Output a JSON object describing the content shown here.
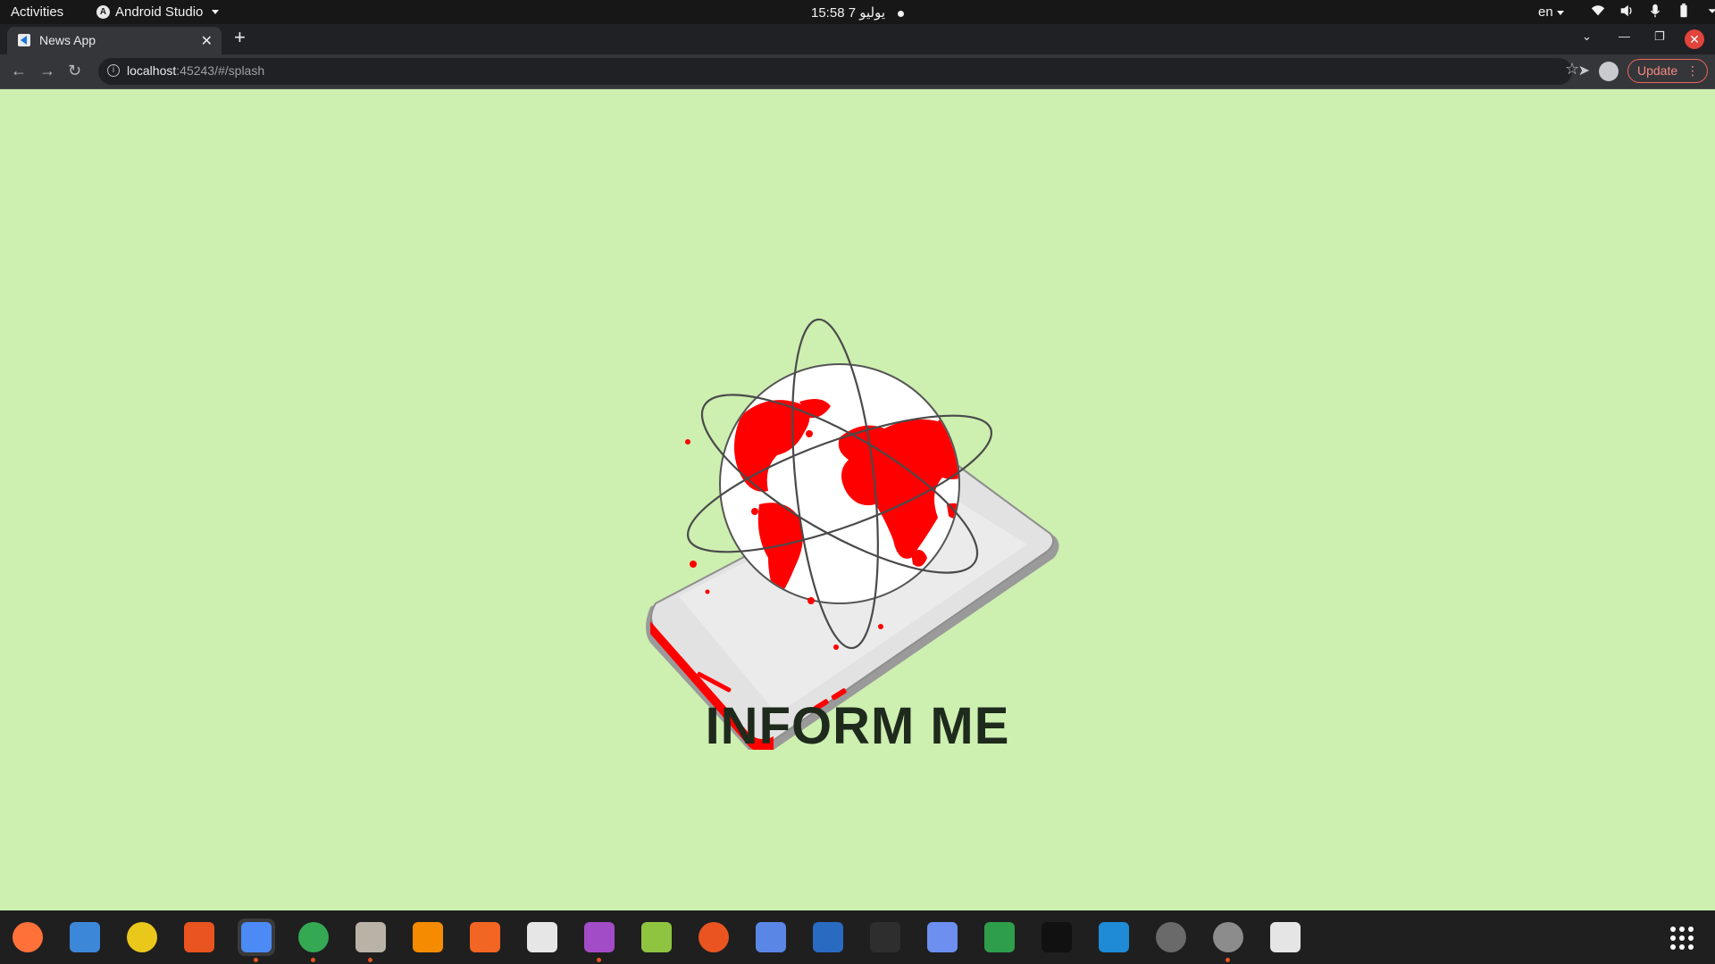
{
  "topbar": {
    "activities": "Activities",
    "app_name": "Android Studio",
    "clock": "15:58  7 يوليو",
    "lang": "en"
  },
  "browser": {
    "tab_title": "News App",
    "url_host": "localhost",
    "url_path": ":45243/#/splash",
    "update_label": "Update"
  },
  "page": {
    "title": "INFORM ME"
  },
  "colors": {
    "background": "#cdefb0",
    "accent_red": "#ff0000",
    "title": "#1e2a1c"
  },
  "dock": {
    "items": [
      {
        "name": "firefox-icon",
        "color": "#ff7139",
        "running": false
      },
      {
        "name": "thunderbird-icon",
        "color": "#3c87d8",
        "running": false
      },
      {
        "name": "rhythmbox-icon",
        "color": "#e9c81b",
        "running": false
      },
      {
        "name": "software-center-icon",
        "color": "#e95420",
        "running": false
      },
      {
        "name": "android-studio-icon",
        "color": "#4c8bf5",
        "running": true,
        "active": true
      },
      {
        "name": "chrome-icon",
        "color": "#34a853",
        "running": true
      },
      {
        "name": "files-icon",
        "color": "#b9b2a6",
        "running": true
      },
      {
        "name": "vlc-icon",
        "color": "#f48b00",
        "running": false
      },
      {
        "name": "draw-icon",
        "color": "#f26522",
        "running": false
      },
      {
        "name": "text-editor-icon",
        "color": "#e6e6e6",
        "running": false
      },
      {
        "name": "video-icon",
        "color": "#a34cc7",
        "running": true
      },
      {
        "name": "gitkraken-icon",
        "color": "#8fc441",
        "running": false
      },
      {
        "name": "ubuntu-icon",
        "color": "#e95420",
        "running": false
      },
      {
        "name": "tasks-icon",
        "color": "#5a86e6",
        "running": false
      },
      {
        "name": "writer-icon",
        "color": "#2a6bc2",
        "running": false
      },
      {
        "name": "terminal-icon",
        "color": "#2e2e2e",
        "running": false
      },
      {
        "name": "screenshot-icon",
        "color": "#6c8ff0",
        "running": false
      },
      {
        "name": "calc-icon",
        "color": "#2e9e4b",
        "running": false
      },
      {
        "name": "intellij-icon",
        "color": "#111111",
        "running": false
      },
      {
        "name": "vscode-icon",
        "color": "#1f8ad6",
        "running": false
      },
      {
        "name": "app-store-icon",
        "color": "#6a6a6a",
        "running": false
      },
      {
        "name": "settings-icon",
        "color": "#8c8c8c",
        "running": true
      },
      {
        "name": "usb-icon",
        "color": "#e5e5e5",
        "running": false
      }
    ]
  }
}
